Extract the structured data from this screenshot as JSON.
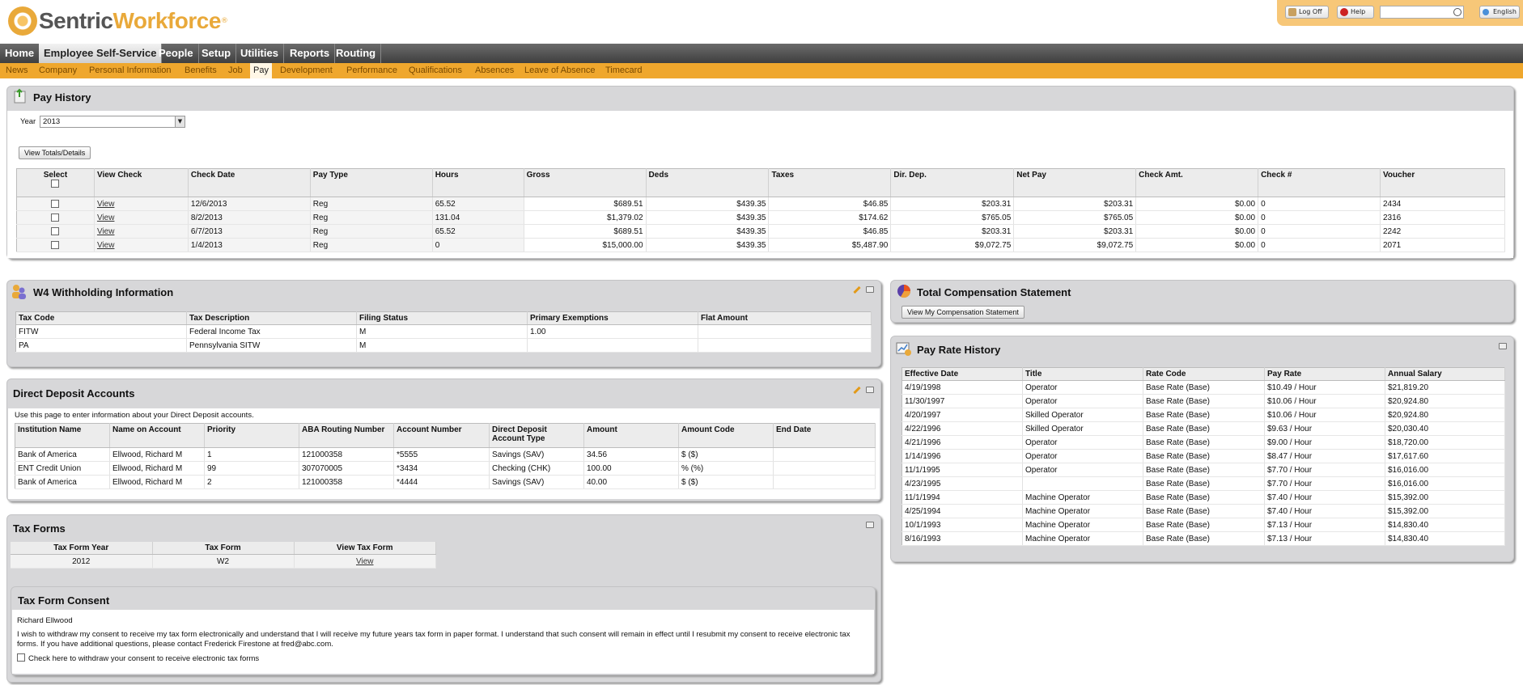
{
  "header": {
    "brand_part1": "Sentric",
    "brand_part2": "Workforce",
    "brand_mark": "®",
    "logoff_label": "Log Off",
    "help_label": "Help",
    "search_value": "",
    "language_label": "English"
  },
  "nav": {
    "items": [
      "Home",
      "Employee Self-Service",
      "People",
      "Setup",
      "Utilities",
      "Reports",
      "Routing"
    ],
    "active": "Employee Self-Service"
  },
  "subnav": {
    "items": [
      "News",
      "Company",
      "Personal Information",
      "Benefits",
      "Job",
      "Pay",
      "Development",
      "Performance",
      "Qualifications",
      "Absences",
      "Leave of Absence",
      "Timecard"
    ],
    "active": "Pay"
  },
  "pay_history": {
    "title": "Pay History",
    "year_label": "Year",
    "year_value": "2013",
    "view_totals_label": "View Totals/Details",
    "columns": [
      "Select",
      "View Check",
      "Check Date",
      "Pay Type",
      "Hours",
      "Gross",
      "Deds",
      "Taxes",
      "Dir. Dep.",
      "Net Pay",
      "Check Amt.",
      "Check #",
      "Voucher"
    ],
    "rows": [
      {
        "view": "View",
        "check_date": "12/6/2013",
        "pay_type": "Reg",
        "hours": "65.52",
        "gross": "$689.51",
        "deds": "$439.35",
        "taxes": "$46.85",
        "dir_dep": "$203.31",
        "net_pay": "$203.31",
        "check_amt": "$0.00",
        "check_no": "0",
        "voucher": "2434"
      },
      {
        "view": "View",
        "check_date": "8/2/2013",
        "pay_type": "Reg",
        "hours": "131.04",
        "gross": "$1,379.02",
        "deds": "$439.35",
        "taxes": "$174.62",
        "dir_dep": "$765.05",
        "net_pay": "$765.05",
        "check_amt": "$0.00",
        "check_no": "0",
        "voucher": "2316"
      },
      {
        "view": "View",
        "check_date": "6/7/2013",
        "pay_type": "Reg",
        "hours": "65.52",
        "gross": "$689.51",
        "deds": "$439.35",
        "taxes": "$46.85",
        "dir_dep": "$203.31",
        "net_pay": "$203.31",
        "check_amt": "$0.00",
        "check_no": "0",
        "voucher": "2242"
      },
      {
        "view": "View",
        "check_date": "1/4/2013",
        "pay_type": "Reg",
        "hours": "0",
        "gross": "$15,000.00",
        "deds": "$439.35",
        "taxes": "$5,487.90",
        "dir_dep": "$9,072.75",
        "net_pay": "$9,072.75",
        "check_amt": "$0.00",
        "check_no": "0",
        "voucher": "2071"
      }
    ]
  },
  "w4": {
    "title": "W4 Withholding Information",
    "columns": [
      "Tax Code",
      "Tax Description",
      "Filing Status",
      "Primary Exemptions",
      "Flat Amount"
    ],
    "rows": [
      {
        "code": "FITW",
        "desc": "Federal Income Tax",
        "status": "M",
        "exemptions": "1.00",
        "flat": ""
      },
      {
        "code": "PA",
        "desc": "Pennsylvania SITW",
        "status": "M",
        "exemptions": "",
        "flat": ""
      }
    ]
  },
  "direct_deposit": {
    "title": "Direct Deposit Accounts",
    "intro": "Use this page to enter information about your Direct Deposit accounts.",
    "columns": [
      "Institution Name",
      "Name on Account",
      "Priority",
      "ABA Routing Number",
      "Account Number",
      "Direct Deposit Account Type",
      "Amount",
      "Amount Code",
      "End Date"
    ],
    "rows": [
      {
        "inst": "Bank of America",
        "name": "Ellwood, Richard M",
        "priority": "1",
        "aba": "121000358",
        "acct": "*5555",
        "type": "Savings (SAV)",
        "amount": "34.56",
        "code": "$ ($)",
        "end": ""
      },
      {
        "inst": "ENT Credit Union",
        "name": "Ellwood, Richard M",
        "priority": "99",
        "aba": "307070005",
        "acct": "*3434",
        "type": "Checking (CHK)",
        "amount": "100.00",
        "code": "% (%)",
        "end": ""
      },
      {
        "inst": "Bank of America",
        "name": "Ellwood, Richard M",
        "priority": "2",
        "aba": "121000358",
        "acct": "*4444",
        "type": "Savings (SAV)",
        "amount": "40.00",
        "code": "$ ($)",
        "end": ""
      }
    ]
  },
  "tax_forms": {
    "title": "Tax Forms",
    "columns": [
      "Tax Form Year",
      "Tax Form",
      "View Tax Form"
    ],
    "rows": [
      {
        "year": "2012",
        "form": "W2",
        "view": "View"
      }
    ],
    "consent": {
      "title": "Tax Form Consent",
      "name": "Richard Ellwood",
      "text_line1": "I wish to withdraw my consent to receive my tax form electronically and understand that I will receive my future years tax form in paper format. I understand that such consent will remain in effect until I resubmit my consent to receive electronic tax",
      "text_line2": "forms. If you have additional questions, please contact Frederick Firestone at fred@abc.com.",
      "checkbox_label": "Check here to withdraw your consent to receive electronic tax forms"
    }
  },
  "total_comp": {
    "title": "Total Compensation Statement",
    "button_label": "View My Compensation Statement"
  },
  "pay_rate": {
    "title": "Pay Rate History",
    "columns": [
      "Effective Date",
      "Title",
      "Rate Code",
      "Pay Rate",
      "Annual Salary"
    ],
    "rows": [
      {
        "date": "4/19/1998",
        "title": "Operator",
        "code": "Base Rate (Base)",
        "rate": "$10.49 / Hour",
        "salary": "$21,819.20"
      },
      {
        "date": "11/30/1997",
        "title": "Operator",
        "code": "Base Rate (Base)",
        "rate": "$10.06 / Hour",
        "salary": "$20,924.80"
      },
      {
        "date": "4/20/1997",
        "title": "Skilled Operator",
        "code": "Base Rate (Base)",
        "rate": "$10.06 / Hour",
        "salary": "$20,924.80"
      },
      {
        "date": "4/22/1996",
        "title": "Skilled Operator",
        "code": "Base Rate (Base)",
        "rate": "$9.63 / Hour",
        "salary": "$20,030.40"
      },
      {
        "date": "4/21/1996",
        "title": "Operator",
        "code": "Base Rate (Base)",
        "rate": "$9.00 / Hour",
        "salary": "$18,720.00"
      },
      {
        "date": "1/14/1996",
        "title": "Operator",
        "code": "Base Rate (Base)",
        "rate": "$8.47 / Hour",
        "salary": "$17,617.60"
      },
      {
        "date": "11/1/1995",
        "title": "Operator",
        "code": "Base Rate (Base)",
        "rate": "$7.70 / Hour",
        "salary": "$16,016.00"
      },
      {
        "date": "4/23/1995",
        "title": "",
        "code": "Base Rate (Base)",
        "rate": "$7.70 / Hour",
        "salary": "$16,016.00"
      },
      {
        "date": "11/1/1994",
        "title": "Machine Operator",
        "code": "Base Rate (Base)",
        "rate": "$7.40 / Hour",
        "salary": "$15,392.00"
      },
      {
        "date": "4/25/1994",
        "title": "Machine Operator",
        "code": "Base Rate (Base)",
        "rate": "$7.40 / Hour",
        "salary": "$15,392.00"
      },
      {
        "date": "10/1/1993",
        "title": "Machine Operator",
        "code": "Base Rate (Base)",
        "rate": "$7.13 / Hour",
        "salary": "$14,830.40"
      },
      {
        "date": "8/16/1993",
        "title": "Machine Operator",
        "code": "Base Rate (Base)",
        "rate": "$7.13 / Hour",
        "salary": "$14,830.40"
      }
    ]
  }
}
